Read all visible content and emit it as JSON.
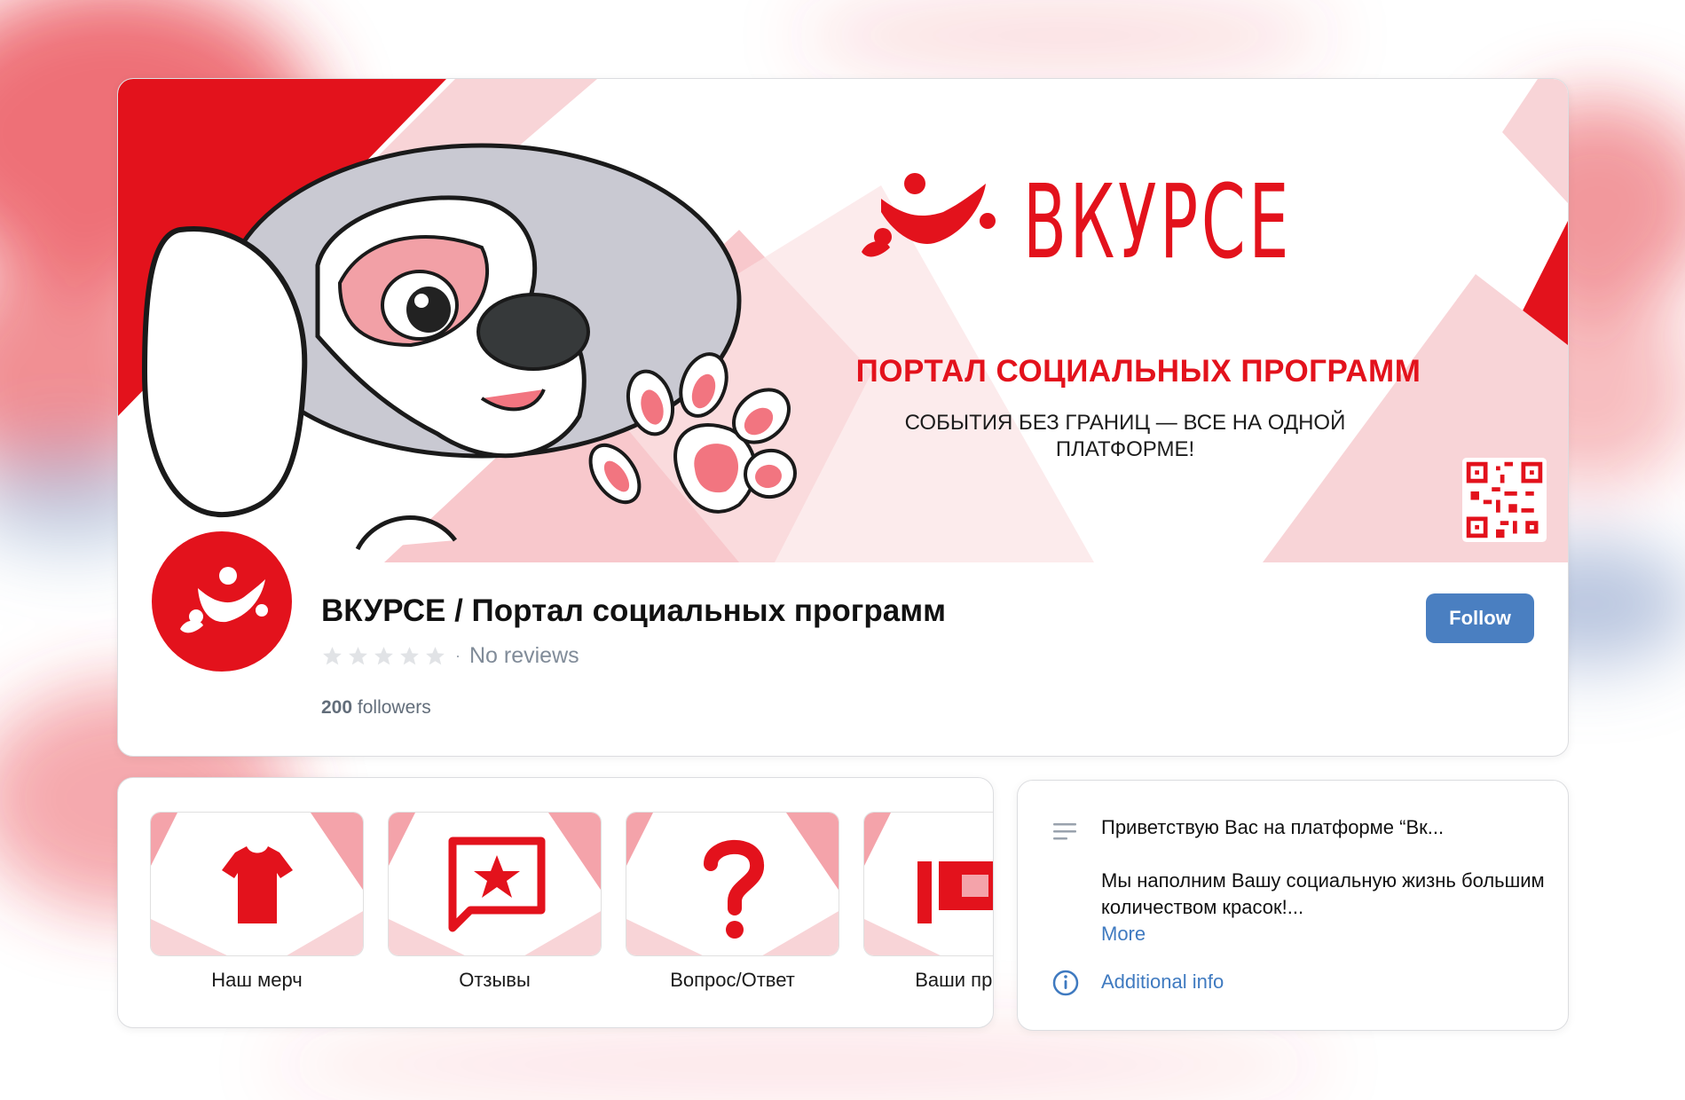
{
  "cover": {
    "brand": "ВКУРСЕ",
    "subtitle": "ПОРТАЛ СОЦИАЛЬНЫХ ПРОГРАММ",
    "tagline": "СОБЫТИЯ БЕЗ ГРАНИЦ — ВСЕ НА ОДНОЙ ПЛАТФОРМЕ!"
  },
  "profile": {
    "title": "ВКУРСЕ / Портал социальных программ",
    "rating_stars": 0,
    "reviews": "No reviews",
    "followers_count": "200",
    "followers_label": "followers",
    "follow_button": "Follow"
  },
  "links": [
    {
      "label": "Наш мерч",
      "icon": "tshirt-icon"
    },
    {
      "label": "Отзывы",
      "icon": "star-message-icon"
    },
    {
      "label": "Вопрос/Ответ",
      "icon": "question-icon"
    },
    {
      "label": "Ваши предл",
      "icon": "flag-icon"
    }
  ],
  "info": {
    "greeting": "Приветствую Вас на платформе “Вк...",
    "description": "Мы наполним Вашу социальную жизнь большим количеством красок!...",
    "more": "More",
    "additional": "Additional info"
  },
  "colors": {
    "brand_red": "#e3121c",
    "pink": "#f4a3aa",
    "link_blue": "#3f7ac0",
    "button_blue": "#4a7fc1"
  }
}
